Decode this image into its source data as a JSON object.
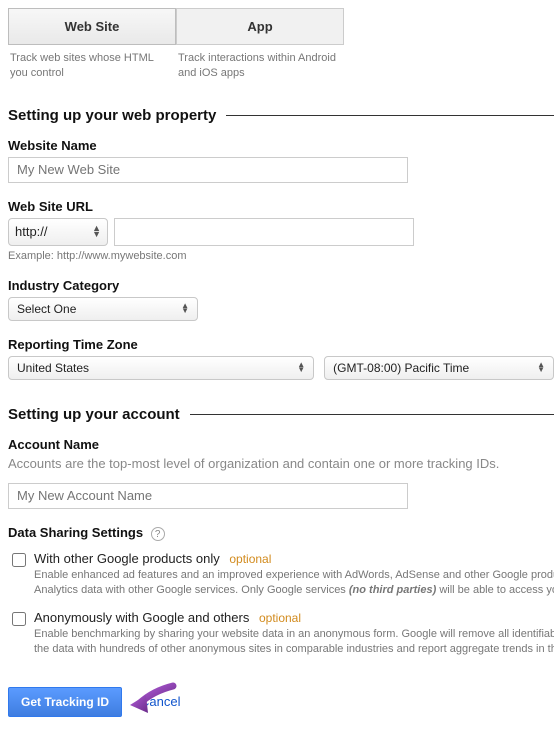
{
  "tabs": {
    "website": {
      "label": "Web Site",
      "desc": "Track web sites whose HTML you control"
    },
    "app": {
      "label": "App",
      "desc": "Track interactions within Android and iOS apps"
    }
  },
  "section1": {
    "heading": "Setting up your web property",
    "website_name_label": "Website Name",
    "website_name_placeholder": "My New Web Site",
    "website_url_label": "Web Site URL",
    "protocol_value": "http://",
    "url_example": "Example: http://www.mywebsite.com",
    "industry_label": "Industry Category",
    "industry_value": "Select One",
    "tz_label": "Reporting Time Zone",
    "tz_country": "United States",
    "tz_value": "(GMT-08:00) Pacific Time"
  },
  "section2": {
    "heading": "Setting up your account",
    "account_name_label": "Account Name",
    "account_desc": "Accounts are the top-most level of organization and contain one or more tracking IDs.",
    "account_name_placeholder": "My New Account Name",
    "sharing_label": "Data Sharing Settings",
    "opt_label": "optional",
    "share1": {
      "title": "With other Google products only",
      "desc_a": "Enable enhanced ad features and an improved experience with AdWords, AdSense and other Google products by sharing your website's Google",
      "desc_b": "Analytics data with other Google services. Only Google services ",
      "desc_em": "(no third parties)",
      "desc_c": " will be able to access your data."
    },
    "share2": {
      "title": "Anonymously with Google and others",
      "desc_a": "Enable benchmarking by sharing your website data in an anonymous form. Google will remove all identifiable information about your website, combine",
      "desc_b": "the data with hundreds of other anonymous sites in comparable industries and report aggregate trends in the benchmarking service."
    }
  },
  "actions": {
    "primary": "Get Tracking ID",
    "cancel": "Cancel"
  }
}
